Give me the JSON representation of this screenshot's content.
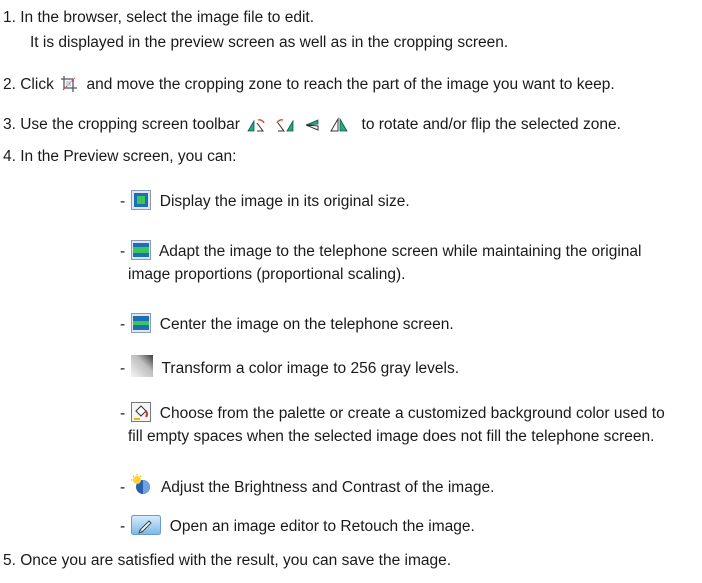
{
  "steps": {
    "s1": "1. In the browser, select the image file to edit.",
    "s1b": "It is displayed in the preview screen as well as in the cropping screen.",
    "s2a": "2. Click",
    "s2b": "and move the cropping zone to reach the part of the image you want to keep.",
    "s3a": "3. Use the cropping screen toolbar",
    "s3b": "to rotate and/or flip the selected zone.",
    "s4": "4. In the Preview screen, you can:",
    "s5": "5. Once you are satisfied with the result, you can save the image."
  },
  "options": {
    "o1": "Display the image in its original size.",
    "o2a": "Adapt the image to the telephone screen while maintaining the original",
    "o2b": "image proportions (proportional scaling).",
    "o3": "Center the image on the telephone screen.",
    "o4": "Transform a color image to 256 gray levels.",
    "o5a": "Choose from the palette or create a customized background color used to",
    "o5b": "fill empty spaces when the selected image does not fill the telephone screen.",
    "o6": "Adjust the Brightness and Contrast of the image.",
    "o7": "Open an image editor to Retouch the image."
  },
  "dash": "-"
}
